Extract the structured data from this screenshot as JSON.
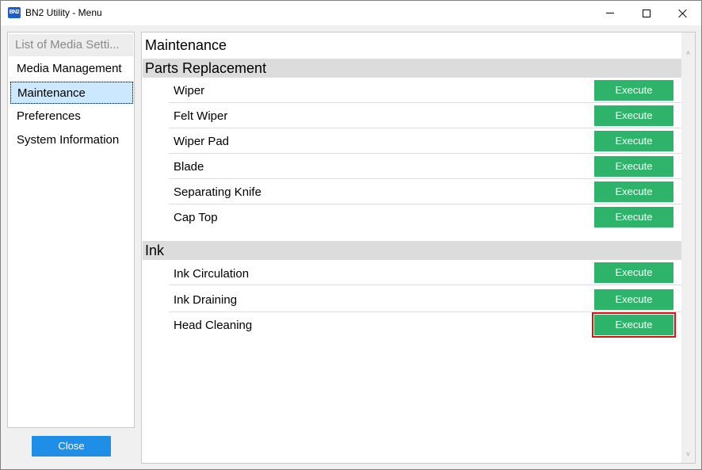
{
  "window": {
    "title": "BN2 Utility - Menu",
    "app_icon_text": "BN2"
  },
  "nav": {
    "items": [
      {
        "label": "List of Media Setti...",
        "state": "header"
      },
      {
        "label": "Media Management",
        "state": "normal"
      },
      {
        "label": "Maintenance",
        "state": "selected"
      },
      {
        "label": "Preferences",
        "state": "normal"
      },
      {
        "label": "System Information",
        "state": "normal"
      }
    ],
    "close_label": "Close"
  },
  "main": {
    "title": "Maintenance",
    "sections": [
      {
        "title": "Parts Replacement",
        "rows": [
          {
            "label": "Wiper",
            "button": "Execute"
          },
          {
            "label": "Felt Wiper",
            "button": "Execute"
          },
          {
            "label": "Wiper Pad",
            "button": "Execute"
          },
          {
            "label": "Blade",
            "button": "Execute"
          },
          {
            "label": "Separating Knife",
            "button": "Execute"
          },
          {
            "label": "Cap Top",
            "button": "Execute"
          }
        ]
      },
      {
        "title": "Ink",
        "rows": [
          {
            "label": "Ink Circulation",
            "button": "Execute"
          },
          {
            "label": "Ink Draining",
            "button": "Execute"
          },
          {
            "label": "Head Cleaning",
            "button": "Execute",
            "highlighted": true
          }
        ]
      }
    ]
  },
  "colors": {
    "execute_button": "#2db36a",
    "close_button": "#1e8ee6",
    "selection": "#cce8ff",
    "highlight_outline": "#e01010"
  }
}
